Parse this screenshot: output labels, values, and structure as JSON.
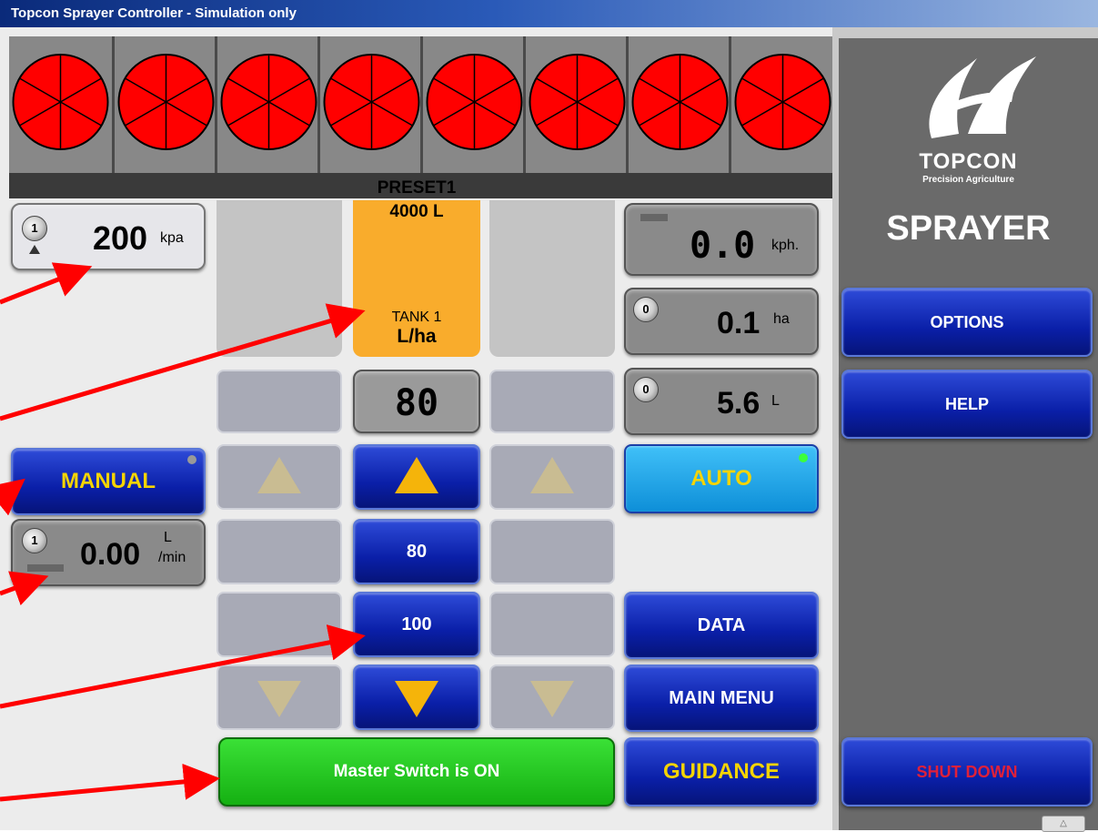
{
  "window": {
    "title": "Topcon Sprayer Controller  - Simulation only"
  },
  "valves": {
    "count": 8,
    "color": "#ff0000"
  },
  "preset": {
    "label": "PRESET1",
    "volume": "4000 L",
    "tank": "TANK 1",
    "unit": "L/ha",
    "color": "#f9ac2c"
  },
  "pressure": {
    "knob": "1",
    "value": "200",
    "unit": "kpa"
  },
  "flow": {
    "knob": "1",
    "value": "0.00",
    "unit_top": "L",
    "unit_bottom": "/min"
  },
  "rate": {
    "value": "80"
  },
  "presets_list": {
    "first": "80",
    "second": "100"
  },
  "speed": {
    "value": "0.0",
    "unit": "kph."
  },
  "area": {
    "knob": "0",
    "value": "0.1",
    "unit": "ha"
  },
  "volume": {
    "knob": "0",
    "value": "5.6",
    "unit": "L"
  },
  "buttons": {
    "manual": "MANUAL",
    "auto": "AUTO",
    "data": "DATA",
    "main_menu": "MAIN MENU",
    "guidance": "GUIDANCE",
    "master": "Master Switch is ON",
    "options": "OPTIONS",
    "help": "HELP",
    "shutdown": "SHUT DOWN"
  },
  "sidebar": {
    "brand": "TOPCON",
    "brand_sub": "Precision Agriculture",
    "module": "SPRAYER"
  },
  "colors": {
    "accent_blue": "#0a1fa8",
    "master_green": "#22c81e",
    "auto_cyan": "#1aa0e6",
    "shutdown_red": "#e0203a",
    "annotation_arrow": "#ff0000"
  }
}
